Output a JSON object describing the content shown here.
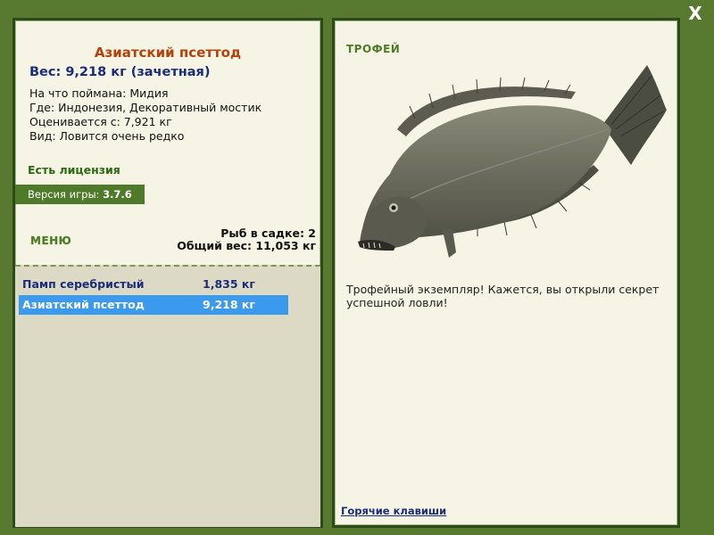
{
  "window": {
    "close_label": "X"
  },
  "fish": {
    "name": "Азиатский псеттод",
    "weight": "Вес: 9,218 кг (зачетная)",
    "caught_on": "На что поймана: Мидия",
    "location": "Где: Индонезия, Декоративный мостик",
    "valued_from": "Оценивается с: 7,921 кг",
    "rarity": "Вид: Ловится очень редко"
  },
  "license": "Есть лицензия",
  "version": {
    "label": "Версия игры:",
    "value": "3.7.6"
  },
  "menu_label": "МЕНЮ",
  "keepnet": {
    "count": "Рыб в садке: 2",
    "total_weight": "Общий вес: 11,053 кг",
    "items": [
      {
        "name": "Памп серебристый",
        "weight": "1,835 кг",
        "selected": false
      },
      {
        "name": "Азиатский псеттод",
        "weight": "9,218 кг",
        "selected": true
      }
    ]
  },
  "trophy": {
    "label": "ТРОФЕЙ",
    "text": "Трофейный экземпляр! Кажется, вы открыли секрет успешной ловли!"
  },
  "hotkeys_link": "Горячие клавиши",
  "colors": {
    "frame": "#587a30",
    "panel": "#f6f4e4",
    "title": "#b4410c",
    "weight": "#1a2d7a",
    "selected_row": "#3b9aee"
  }
}
